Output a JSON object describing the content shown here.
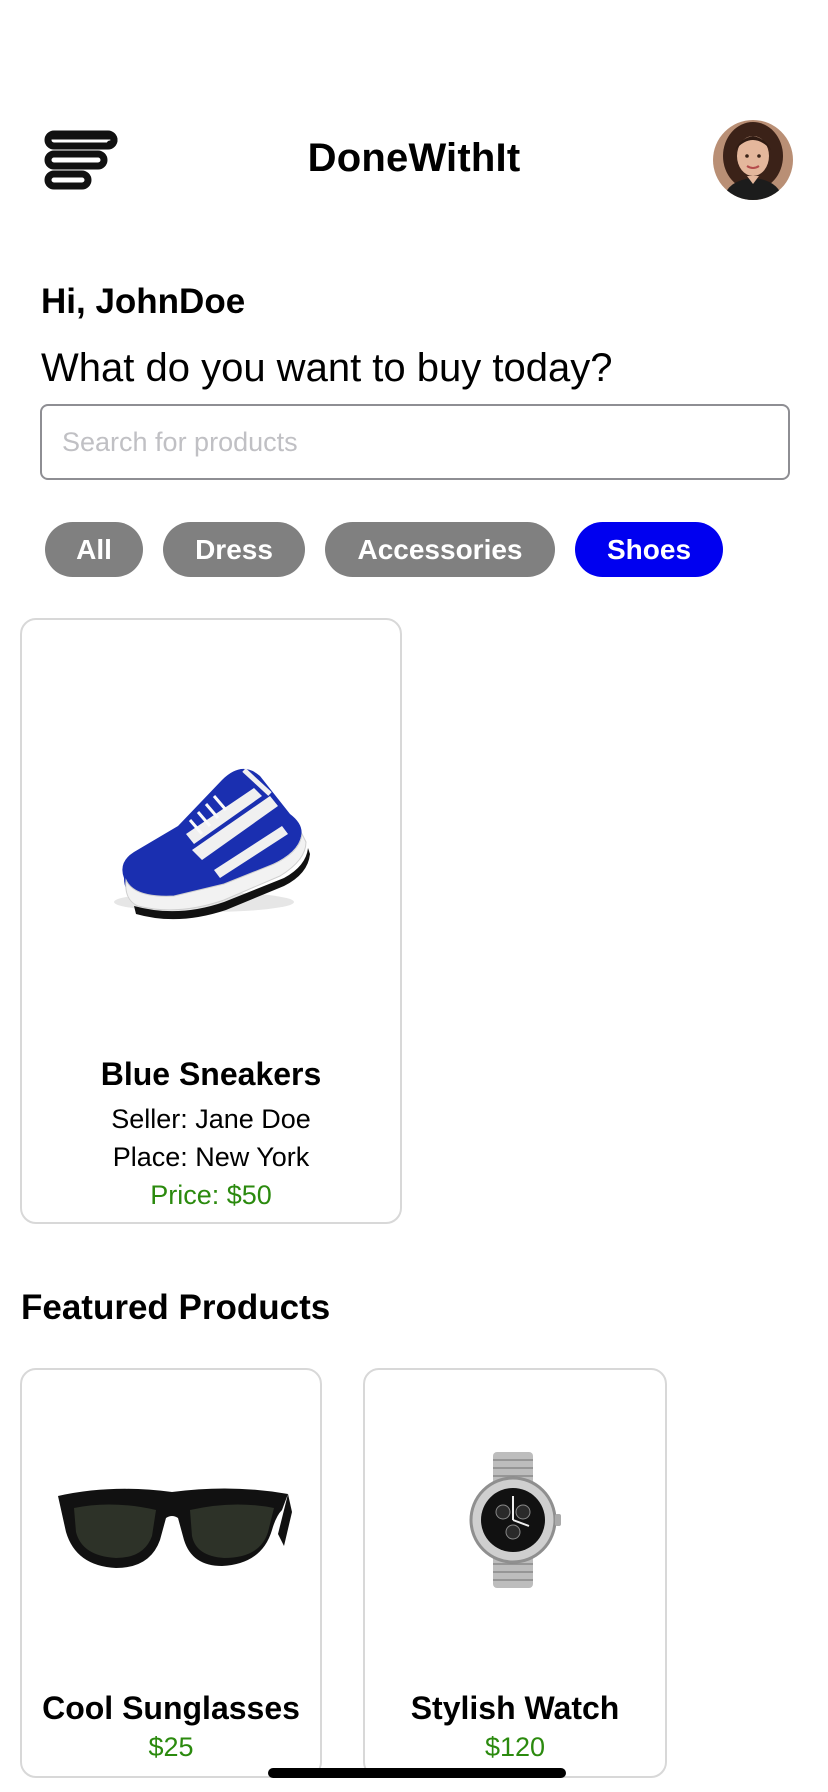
{
  "header": {
    "title": "DoneWithIt",
    "menu_icon": "menu-icon",
    "avatar_icon": "user-avatar"
  },
  "greeting": {
    "hello": "Hi, JohnDoe",
    "question": "What do you want to buy today?"
  },
  "search": {
    "placeholder": "Search for products",
    "value": ""
  },
  "categories": [
    {
      "label": "All",
      "active": false
    },
    {
      "label": "Dress",
      "active": false
    },
    {
      "label": "Accessories",
      "active": false
    },
    {
      "label": "Shoes",
      "active": true
    }
  ],
  "colors": {
    "chip_inactive": "#808080",
    "chip_active": "#0000f0",
    "price": "#2b8a0e"
  },
  "products": [
    {
      "name": "Blue Sneakers",
      "seller": "Seller: Jane Doe",
      "place": "Place: New York",
      "price": "Price: $50",
      "image_icon": "sneaker-image"
    }
  ],
  "featured": {
    "title": "Featured Products",
    "items": [
      {
        "name": "Cool Sunglasses",
        "price": "$25",
        "image_icon": "sunglasses-image"
      },
      {
        "name": "Stylish Watch",
        "price": "$120",
        "image_icon": "watch-image"
      }
    ]
  }
}
